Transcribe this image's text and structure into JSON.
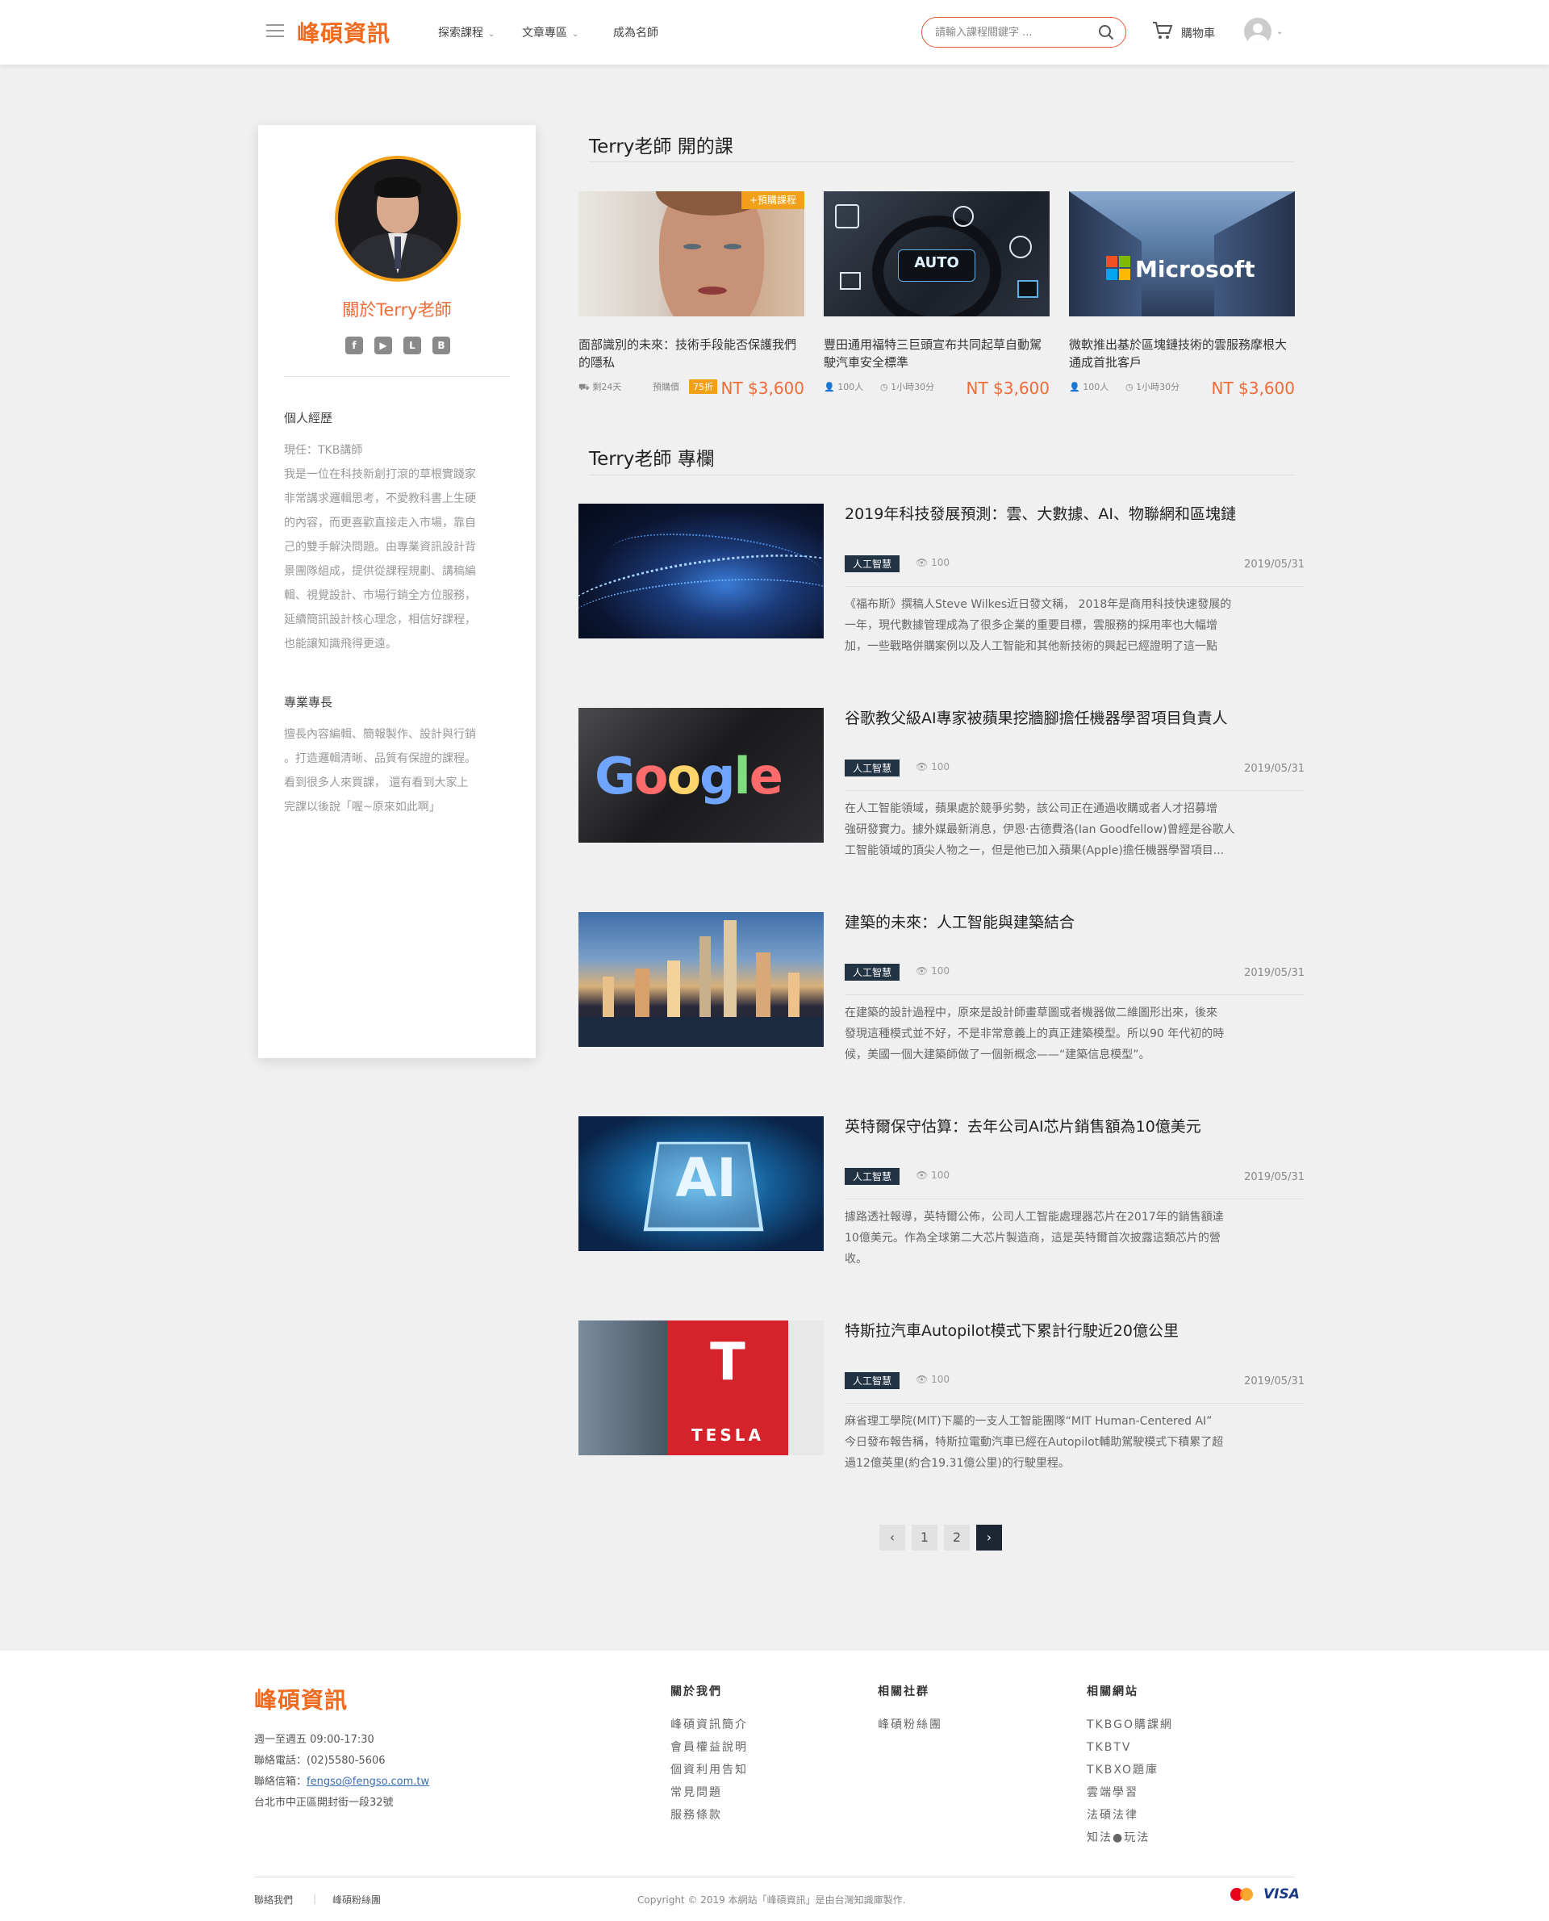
{
  "header": {
    "brand": "峰碩資訊",
    "nav": [
      "探索課程",
      "文章專區",
      "成為名師"
    ],
    "search_placeholder": "請輸入課程關鍵字 ...",
    "cart_label": "購物車"
  },
  "sidebar": {
    "about_title": "關於Terry老師",
    "social_icons": [
      "facebook-icon",
      "youtube-icon",
      "line-icon",
      "blog-icon"
    ],
    "resume_heading": "個人經歷",
    "resume_lines": [
      "現任：TKB講師",
      "我是一位在科技新創打滾的草根實踐家",
      "非常講求邏輯思考，不愛教科書上生硬",
      "的內容，而更喜歡直接走入市場，靠自",
      "己的雙手解決問題。由專業資訊設計背",
      "景團隊組成，提供從課程規劃、講稿編",
      "輯、視覺設計、市場行銷全方位服務，",
      "延續簡訊設計核心理念，相信好課程，",
      "也能讓知識飛得更遠。"
    ],
    "skills_heading": "專業專長",
    "skills_lines": [
      "擅長內容編輯、簡報製作、設計與行銷",
      "。打造邏輯清晰、品質有保證的課程。",
      "看到很多人來買課， 還有看到大家上",
      "完課以後說「喔~原來如此啊」"
    ]
  },
  "courses_section_title": "Terry老師 開的課",
  "courses": [
    {
      "title": "面部識別的未來：技術手段能否保護我們的隱私",
      "badge": "+預購課程",
      "meta1": "剩24天",
      "meta2": "預購價",
      "discount": "75折",
      "price": "NT $3,600"
    },
    {
      "title": "豐田通用福特三巨頭宣布共同起草自動駕駛汽車安全標準",
      "meta1": "100人",
      "meta2": "1小時30分",
      "price": "NT $3,600"
    },
    {
      "title": "微軟推出基於區塊鏈技術的雲服務摩根大通成首批客戶",
      "meta1": "100人",
      "meta2": "1小時30分",
      "price": "NT $3,600",
      "image_text": "Microsoft"
    }
  ],
  "column_section_title": "Terry老師 專欄",
  "articles": [
    {
      "title": "2019年科技發展預測：雲、大數據、AI、物聯網和區塊鏈",
      "tag": "人工智慧",
      "views": "100",
      "date": "2019/05/31",
      "lines": [
        "《福布斯》撰稿人Steve Wilkes近日發文稱， 2018年是商用科技快速發展的",
        "一年，現代數據管理成為了很多企業的重要目標，雲服務的採用率也大幅增",
        "加，一些戰略併購案例以及人工智能和其他新技術的興起已經證明了這一點"
      ]
    },
    {
      "title": "谷歌教父級AI專家被蘋果挖牆腳擔任機器學習項目負責人",
      "tag": "人工智慧",
      "views": "100",
      "date": "2019/05/31",
      "image_text": "Google",
      "lines": [
        "在人工智能領域，蘋果處於競爭劣勢，該公司正在通過收購或者人才招募增",
        "強研發實力。據外媒最新消息，伊恩·古德費洛(Ian Goodfellow)曾經是谷歌人",
        "工智能領域的頂尖人物之一，但是他已加入蘋果(Apple)擔任機器學習項目..."
      ]
    },
    {
      "title": "建築的未來：人工智能與建築結合",
      "tag": "人工智慧",
      "views": "100",
      "date": "2019/05/31",
      "lines": [
        "在建築的設計過程中，原來是設計師畫草圖或者機器做二維圖形出來，後來",
        "發現這種模式並不好，不是非常意義上的真正建築模型。所以90 年代初的時",
        "候，美國一個大建築師做了一個新概念——“建築信息模型”。"
      ]
    },
    {
      "title": "英特爾保守估算：去年公司AI芯片銷售額為10億美元",
      "tag": "人工智慧",
      "views": "100",
      "date": "2019/05/31",
      "image_text": "AI",
      "lines": [
        "據路透社報導，英特爾公佈，公司人工智能處理器芯片在2017年的銷售額達",
        "10億美元。作為全球第二大芯片製造商，這是英特爾首次披露這類芯片的營",
        "收。"
      ]
    },
    {
      "title": "特斯拉汽車Autopilot模式下累計行駛近20億公里",
      "tag": "人工智慧",
      "views": "100",
      "date": "2019/05/31",
      "image_text": "TESLA",
      "lines": [
        "麻省理工學院(MIT)下屬的一支人工智能團隊“MIT Human-Centered AI”",
        "今日發布報告稱，特斯拉電動汽車已經在Autopilot輔助駕駛模式下積累了超",
        "過12億英里(約合19.31億公里)的行駛里程。"
      ]
    }
  ],
  "pagination": {
    "prev": "‹",
    "pages": [
      "1",
      "2"
    ],
    "next": "›"
  },
  "footer": {
    "brand": "峰碩資訊",
    "hours_label": "週一至週五",
    "hours": "09:00-17:30",
    "phone_label": "聯絡電話：",
    "phone": "(02)5580-5606",
    "email_label": "聯絡信箱：",
    "email": "fengso@fengso.com.tw",
    "address": "台北市中正區開封街一段32號",
    "col1": {
      "heading": "關於我們",
      "links": [
        "峰碩資訊簡介",
        "會員權益說明",
        "個資利用告知",
        "常見問題",
        "服務條款"
      ]
    },
    "col2": {
      "heading": "相關社群",
      "links": [
        "峰碩粉絲團"
      ]
    },
    "col3": {
      "heading": "相關網站",
      "links": [
        "TKBGO購課網",
        "TKBTV",
        "TKBXO題庫",
        "雲端學習",
        "法碩法律",
        "知法●玩法"
      ]
    },
    "bottom_links": [
      "聯絡我們",
      "峰碩粉絲團"
    ],
    "copyright": "Copyright © 2019 本網站「峰碩資訊」是由台灣知識庫製作.",
    "payment": [
      "mastercard-icon",
      "VISA"
    ]
  }
}
